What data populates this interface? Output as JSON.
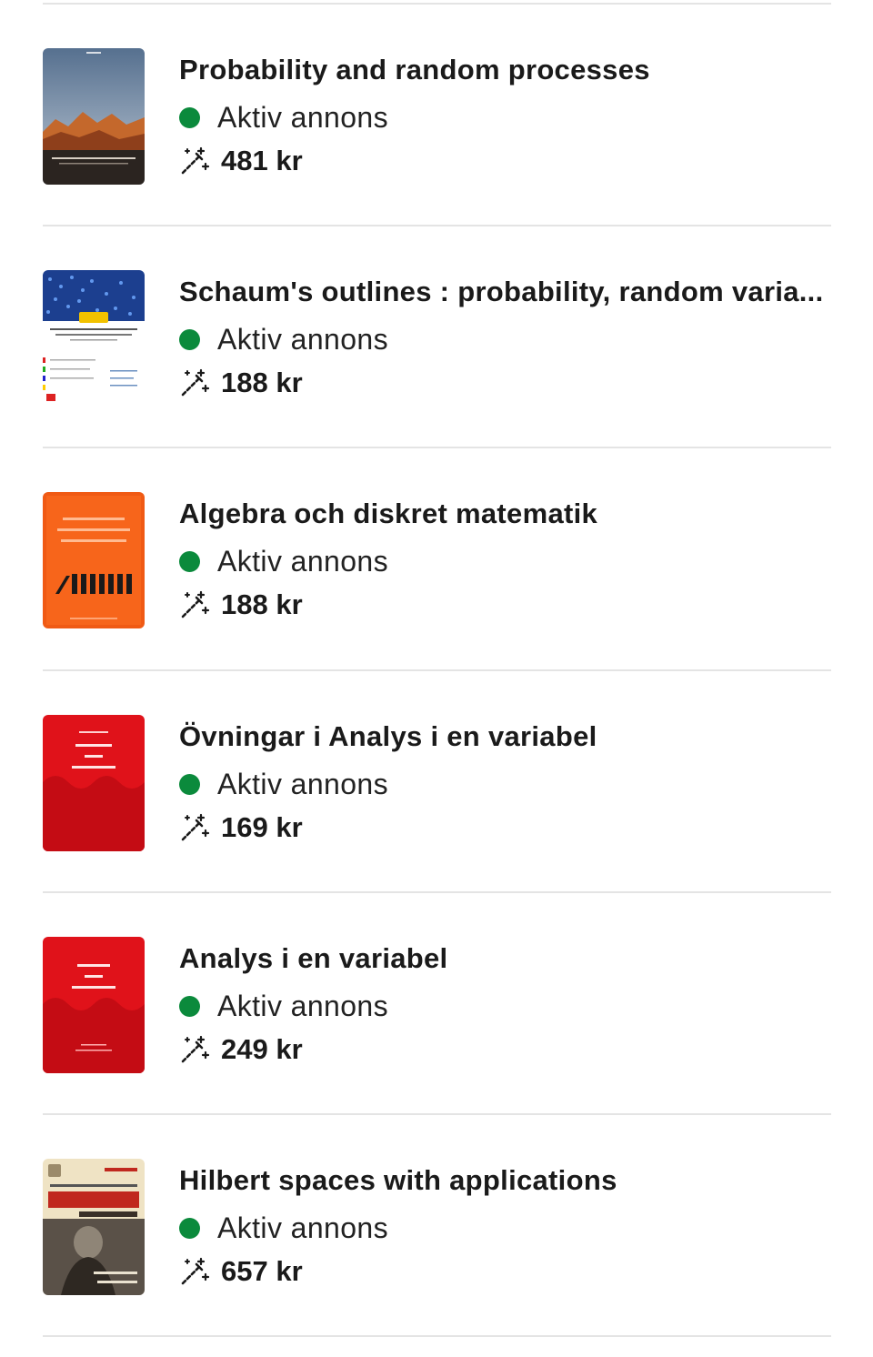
{
  "colors": {
    "status_green": "#0b8a3c",
    "divider": "#e4e4e4",
    "text": "#1a1a1a"
  },
  "icons": {
    "status": "green-dot-icon",
    "price": "magic-wand-icon"
  },
  "listings": [
    {
      "title": "Probability and random processes",
      "status": "Aktiv annons",
      "price": "481 kr",
      "cover": {
        "kind": "photo",
        "text": "PROBABILITY AND RANDOM PROCESSES",
        "colors": [
          "#6b7f96",
          "#c96a2e"
        ]
      }
    },
    {
      "title": "Schaum's outlines : probability, random varia...",
      "status": "Aktiv annons",
      "price": "188 kr",
      "cover": {
        "kind": "schaum",
        "text": "Probability, Random Variables, and Random Processes",
        "colors": [
          "#1c3f8f",
          "#ffffff"
        ]
      }
    },
    {
      "title": "Algebra och diskret matematik",
      "status": "Aktiv annons",
      "price": "188 kr",
      "cover": {
        "kind": "orange",
        "text": "ALGEBRA OCH DISKRET MATEMATIK",
        "colors": [
          "#f05a14",
          "#ff7a2c"
        ]
      }
    },
    {
      "title": "Övningar i Analys i en variabel",
      "status": "Aktiv annons",
      "price": "169 kr",
      "cover": {
        "kind": "red",
        "text": "Övningar i ANALYS I EN VARIABEL",
        "colors": [
          "#e0121a",
          "#c40c14"
        ]
      }
    },
    {
      "title": "Analys i en variabel",
      "status": "Aktiv annons",
      "price": "249 kr",
      "cover": {
        "kind": "red2",
        "text": "ANALYS I EN VARIABEL",
        "colors": [
          "#e0121a",
          "#c40c14"
        ]
      }
    },
    {
      "title": "Hilbert spaces with applications",
      "status": "Aktiv annons",
      "price": "657 kr",
      "cover": {
        "kind": "hilbert",
        "text": "INTRODUCTION TO HILBERT SPACES",
        "colors": [
          "#efe3c4",
          "#c0281e"
        ]
      }
    }
  ]
}
